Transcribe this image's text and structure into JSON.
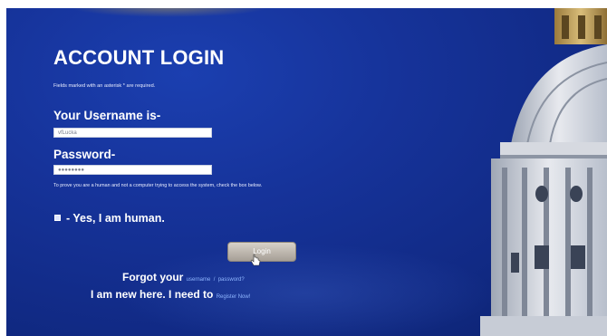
{
  "login": {
    "title": "ACCOUNT LOGIN",
    "required_note": "Fields marked with an asterisk * are required.",
    "username_label": "Your Username is-",
    "username_value": "vfLucka",
    "password_label": "Password-",
    "password_value": "●●●●●●●●",
    "human_note": "To prove you are a human and not a computer trying to access the system, check the box below.",
    "human_check_label": "- Yes, I am human.",
    "login_button": "Login",
    "forgot_prefix": "Forgot your",
    "username_link": "username",
    "separator": "/",
    "password_link": "password?",
    "new_prefix": "I am new here. I need to",
    "register_link": "Register Now!"
  },
  "colors": {
    "background": "#112a85",
    "link": "#8fb6ff",
    "button": "#bdb6ad"
  },
  "icons": {
    "checkbox": "checkbox-icon",
    "cursor": "pointer-cursor-icon",
    "building": "capitol-dome-icon"
  }
}
